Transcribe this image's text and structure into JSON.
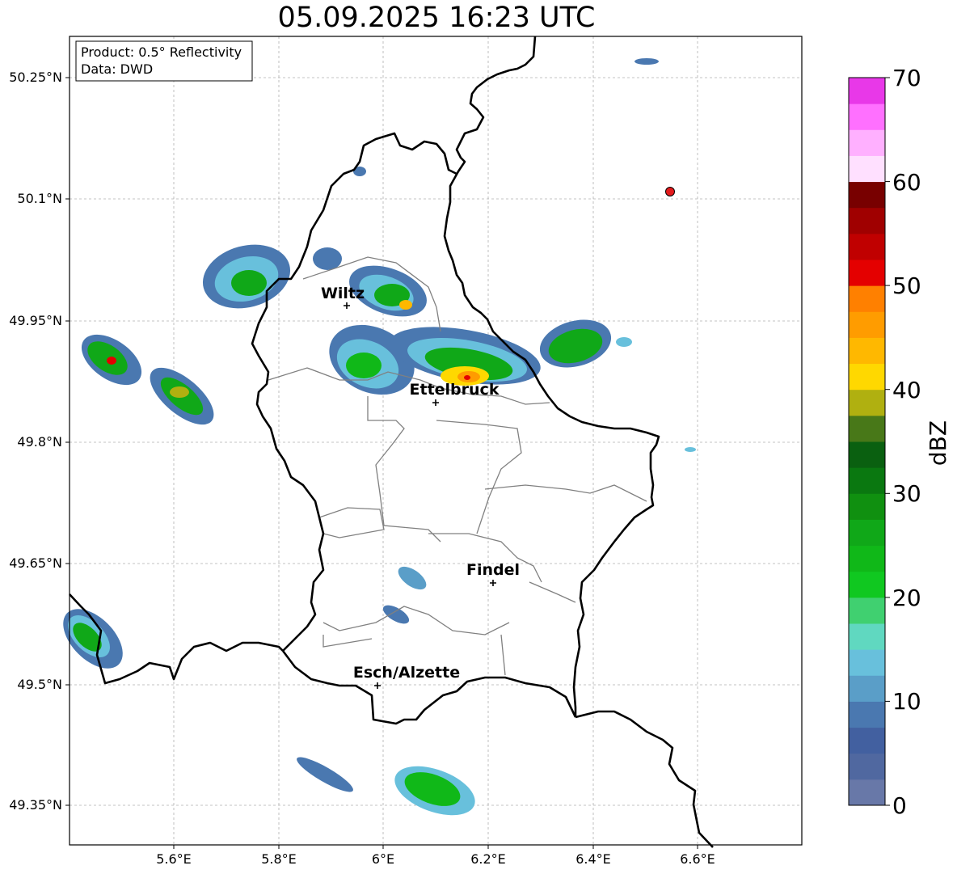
{
  "title": "05.09.2025 16:23 UTC",
  "info_box": {
    "product": "Product: 0.5° Reflectivity",
    "data": "Data: DWD"
  },
  "map": {
    "x_ticks": [
      "5.6°E",
      "5.8°E",
      "6°E",
      "6.2°E",
      "6.4°E",
      "6.6°E"
    ],
    "y_ticks": [
      "50.25°N",
      "50.1°N",
      "49.95°N",
      "49.8°N",
      "49.65°N",
      "49.5°N",
      "49.35°N"
    ],
    "cities": [
      {
        "name": "Wiltz"
      },
      {
        "name": "Ettelbruck"
      },
      {
        "name": "Findel"
      },
      {
        "name": "Esch/Alzette"
      }
    ],
    "radar_site_color": "#e31a1c",
    "border_color": "#000000",
    "canton_color": "#808080"
  },
  "colorbar": {
    "label": "dBZ",
    "ticks": [
      "0",
      "10",
      "20",
      "30",
      "40",
      "50",
      "60",
      "70"
    ],
    "colors": [
      "#6878a8",
      "#5068a0",
      "#4260a0",
      "#4a78b0",
      "#5a9ec8",
      "#68c0dc",
      "#60d8c0",
      "#40d070",
      "#10c820",
      "#10b818",
      "#10a818",
      "#109010",
      "#0a7810",
      "#0a6010",
      "#487818",
      "#b0b010",
      "#ffd800",
      "#ffb800",
      "#ff9c00",
      "#ff8000",
      "#e40000",
      "#c00000",
      "#a00000",
      "#780000",
      "#ffe0ff",
      "#ffb0ff",
      "#ff70ff",
      "#e838e8"
    ]
  }
}
